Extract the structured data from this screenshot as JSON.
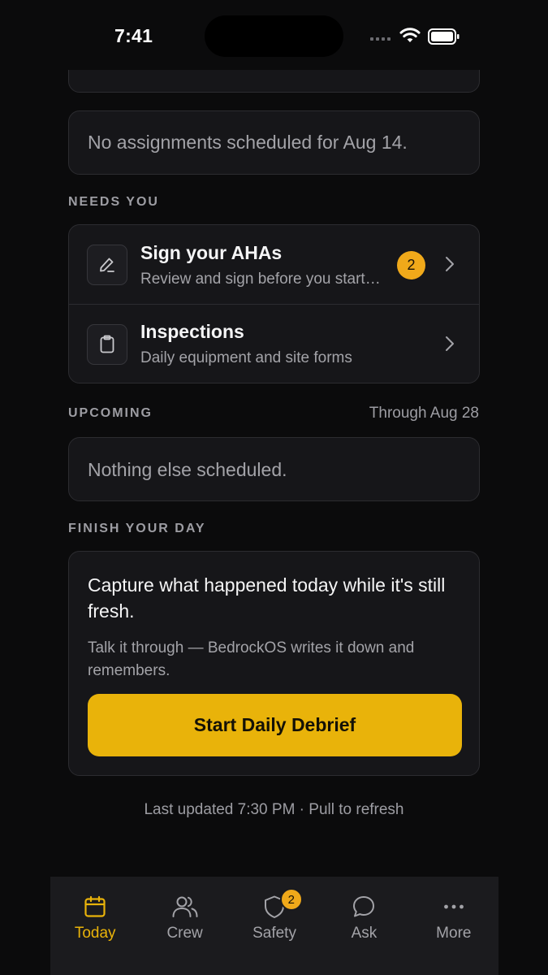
{
  "status_bar": {
    "time": "7:41"
  },
  "today": {
    "empty_text": "No assignments scheduled for Aug 14."
  },
  "needs_you": {
    "label": "NEEDS YOU",
    "items": [
      {
        "title": "Sign your AHAs",
        "subtitle": "Review and sign before you start work",
        "badge": "2",
        "icon": "pencil-icon"
      },
      {
        "title": "Inspections",
        "subtitle": "Daily equipment and site forms",
        "icon": "clipboard-icon"
      }
    ]
  },
  "upcoming": {
    "label": "UPCOMING",
    "range": "Through Aug 28",
    "empty_text": "Nothing else scheduled."
  },
  "finish_day": {
    "label": "FINISH YOUR DAY",
    "title": "Capture what happened today while it's still fresh.",
    "subtitle": "Talk it through — BedrockOS writes it down and remembers.",
    "cta": "Start Daily Debrief"
  },
  "footer": {
    "note": "Last updated 7:30 PM · Pull to refresh"
  },
  "tabs": [
    {
      "label": "Today",
      "icon": "calendar-icon",
      "active": true
    },
    {
      "label": "Crew",
      "icon": "users-icon"
    },
    {
      "label": "Safety",
      "icon": "shield-icon",
      "badge": "2"
    },
    {
      "label": "Ask",
      "icon": "chat-bubble-icon"
    },
    {
      "label": "More",
      "icon": "more-dots-icon"
    }
  ],
  "colors": {
    "accent": "#e9b30a",
    "badge": "#f0a91a",
    "background": "#0b0b0c",
    "card": "#161619"
  }
}
